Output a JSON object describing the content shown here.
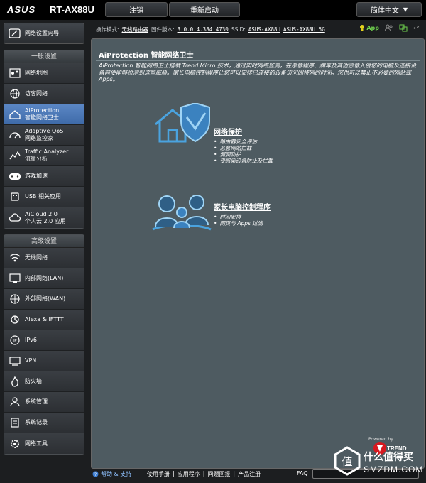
{
  "header": {
    "brand": "ASUS",
    "model": "RT-AX88U",
    "logout_label": "注销",
    "reboot_label": "重新启动",
    "language": "简体中文"
  },
  "sidebar": {
    "qis_label": "网络设置向导",
    "general_title": "一般设置",
    "general_items": [
      {
        "label": "网络地图",
        "sub": ""
      },
      {
        "label": "访客网络",
        "sub": ""
      },
      {
        "label": "AiProtection",
        "sub": "智能网络卫士"
      },
      {
        "label": "Adaptive QoS",
        "sub": "网络监控家"
      },
      {
        "label": "Traffic Analyzer",
        "sub": "流量分析"
      },
      {
        "label": "游戏加速",
        "sub": ""
      },
      {
        "label": "USB 相关应用",
        "sub": ""
      },
      {
        "label": "AiCloud 2.0",
        "sub": "个人云 2.0 应用"
      }
    ],
    "advanced_title": "高级设置",
    "advanced_items": [
      {
        "label": "无线网络"
      },
      {
        "label": "内部网络(LAN)"
      },
      {
        "label": "外部网络(WAN)"
      },
      {
        "label": "Alexa & IFTTT"
      },
      {
        "label": "IPv6"
      },
      {
        "label": "VPN"
      },
      {
        "label": "防火墙"
      },
      {
        "label": "系统管理"
      },
      {
        "label": "系统记录"
      },
      {
        "label": "网络工具"
      }
    ]
  },
  "status": {
    "mode_key": "操作模式:",
    "mode_val": "无线路由器",
    "fw_key": "固件版本:",
    "fw_val": "3.0.0.4.384_4730",
    "ssid_key": "SSID:",
    "ssid_1": "ASUS-AX88U",
    "ssid_2": "ASUS-AX88U_5G",
    "app_label": "App"
  },
  "panel": {
    "title": "AiProtection 智能网络卫士",
    "description": "AiProtection 智能网络卫士搭载 Trend Micro 技术，通过实时网络监测，在恶意程序、病毒及其他恶意入侵您的电脑及连接设备前便能够检测到这些威胁。家长电脑控制程序让您可以安排已连接的设备访问因特网的时间。您也可以禁止不必要的网站或 Apps。",
    "network_protection": {
      "title": "网络保护",
      "items": [
        "路由器安全评估",
        "恶意网站拦截",
        "漏洞防护",
        "受感染设备防止及拦截"
      ]
    },
    "parental_controls": {
      "title": "家长电脑控制程序",
      "items": [
        "时间安排",
        "网页与 Apps 过滤"
      ]
    },
    "powered_by": "Powered by",
    "trend_label": "TREND"
  },
  "footer": {
    "help": "帮助 & 支持",
    "links": [
      "使用手册",
      "|",
      "应用程序",
      "|",
      "问题回报",
      "|",
      "产品注册"
    ],
    "faq": "FAQ"
  },
  "watermark": {
    "top": "什么值得买",
    "bottom": "SMZDM.COM"
  },
  "colors": {
    "active_nav": "#4a78b8",
    "panel_bg": "#4e5b61",
    "accent_blue": "#4aa3df",
    "app_green": "#6fd14e"
  }
}
